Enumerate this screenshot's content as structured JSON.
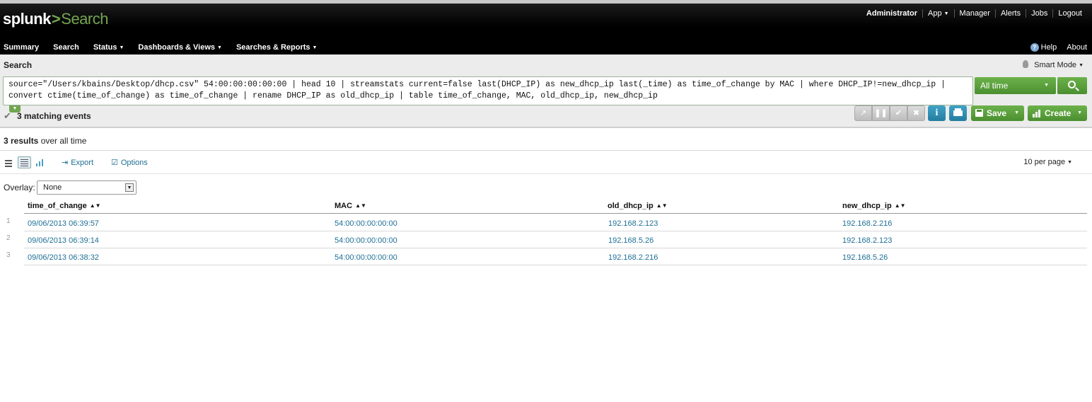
{
  "header": {
    "brand": "splunk",
    "brand_sep": ">",
    "app_name": "Search",
    "top_links": [
      "Administrator",
      "App",
      "Manager",
      "Alerts",
      "Jobs",
      "Logout"
    ],
    "nav": [
      "Summary",
      "Search",
      "Status",
      "Dashboards & Views",
      "Searches & Reports"
    ],
    "help": "Help",
    "about": "About"
  },
  "search": {
    "label": "Search",
    "mode": "Smart Mode",
    "query": "source=\"/Users/kbains/Desktop/dhcp.csv\" 54:00:00:00:00:00 | head 10 | streamstats current=false last(DHCP_IP) as new_dhcp_ip last(_time) as time_of_change by MAC | where DHCP_IP!=new_dhcp_ip | convert ctime(time_of_change) as time_of_change | rename DHCP_IP as old_dhcp_ip | table time_of_change, MAC, old_dhcp_ip, new_dhcp_ip",
    "time_range": "All time",
    "matching": "3 matching events",
    "save_label": "Save",
    "create_label": "Create"
  },
  "results": {
    "count_bold": "3 results",
    "count_rest": " over all time",
    "export": "Export",
    "options": "Options",
    "per_page": "10 per page",
    "overlay_label": "Overlay:",
    "overlay_value": "None",
    "columns": [
      "time_of_change",
      "MAC",
      "old_dhcp_ip",
      "new_dhcp_ip"
    ],
    "rows": [
      {
        "num": "1",
        "cells": [
          "09/06/2013 06:39:57",
          "54:00:00:00:00:00",
          "192.168.2.123",
          "192.168.2.216"
        ]
      },
      {
        "num": "2",
        "cells": [
          "09/06/2013 06:39:14",
          "54:00:00:00:00:00",
          "192.168.5.26",
          "192.168.2.123"
        ]
      },
      {
        "num": "3",
        "cells": [
          "09/06/2013 06:38:32",
          "54:00:00:00:00:00",
          "192.168.2.216",
          "192.168.5.26"
        ]
      }
    ]
  },
  "colors": {
    "brand_green": "#73a550",
    "button_green": "#4b8f30",
    "link_blue": "#1e6f95",
    "info_blue": "#237d9f"
  }
}
